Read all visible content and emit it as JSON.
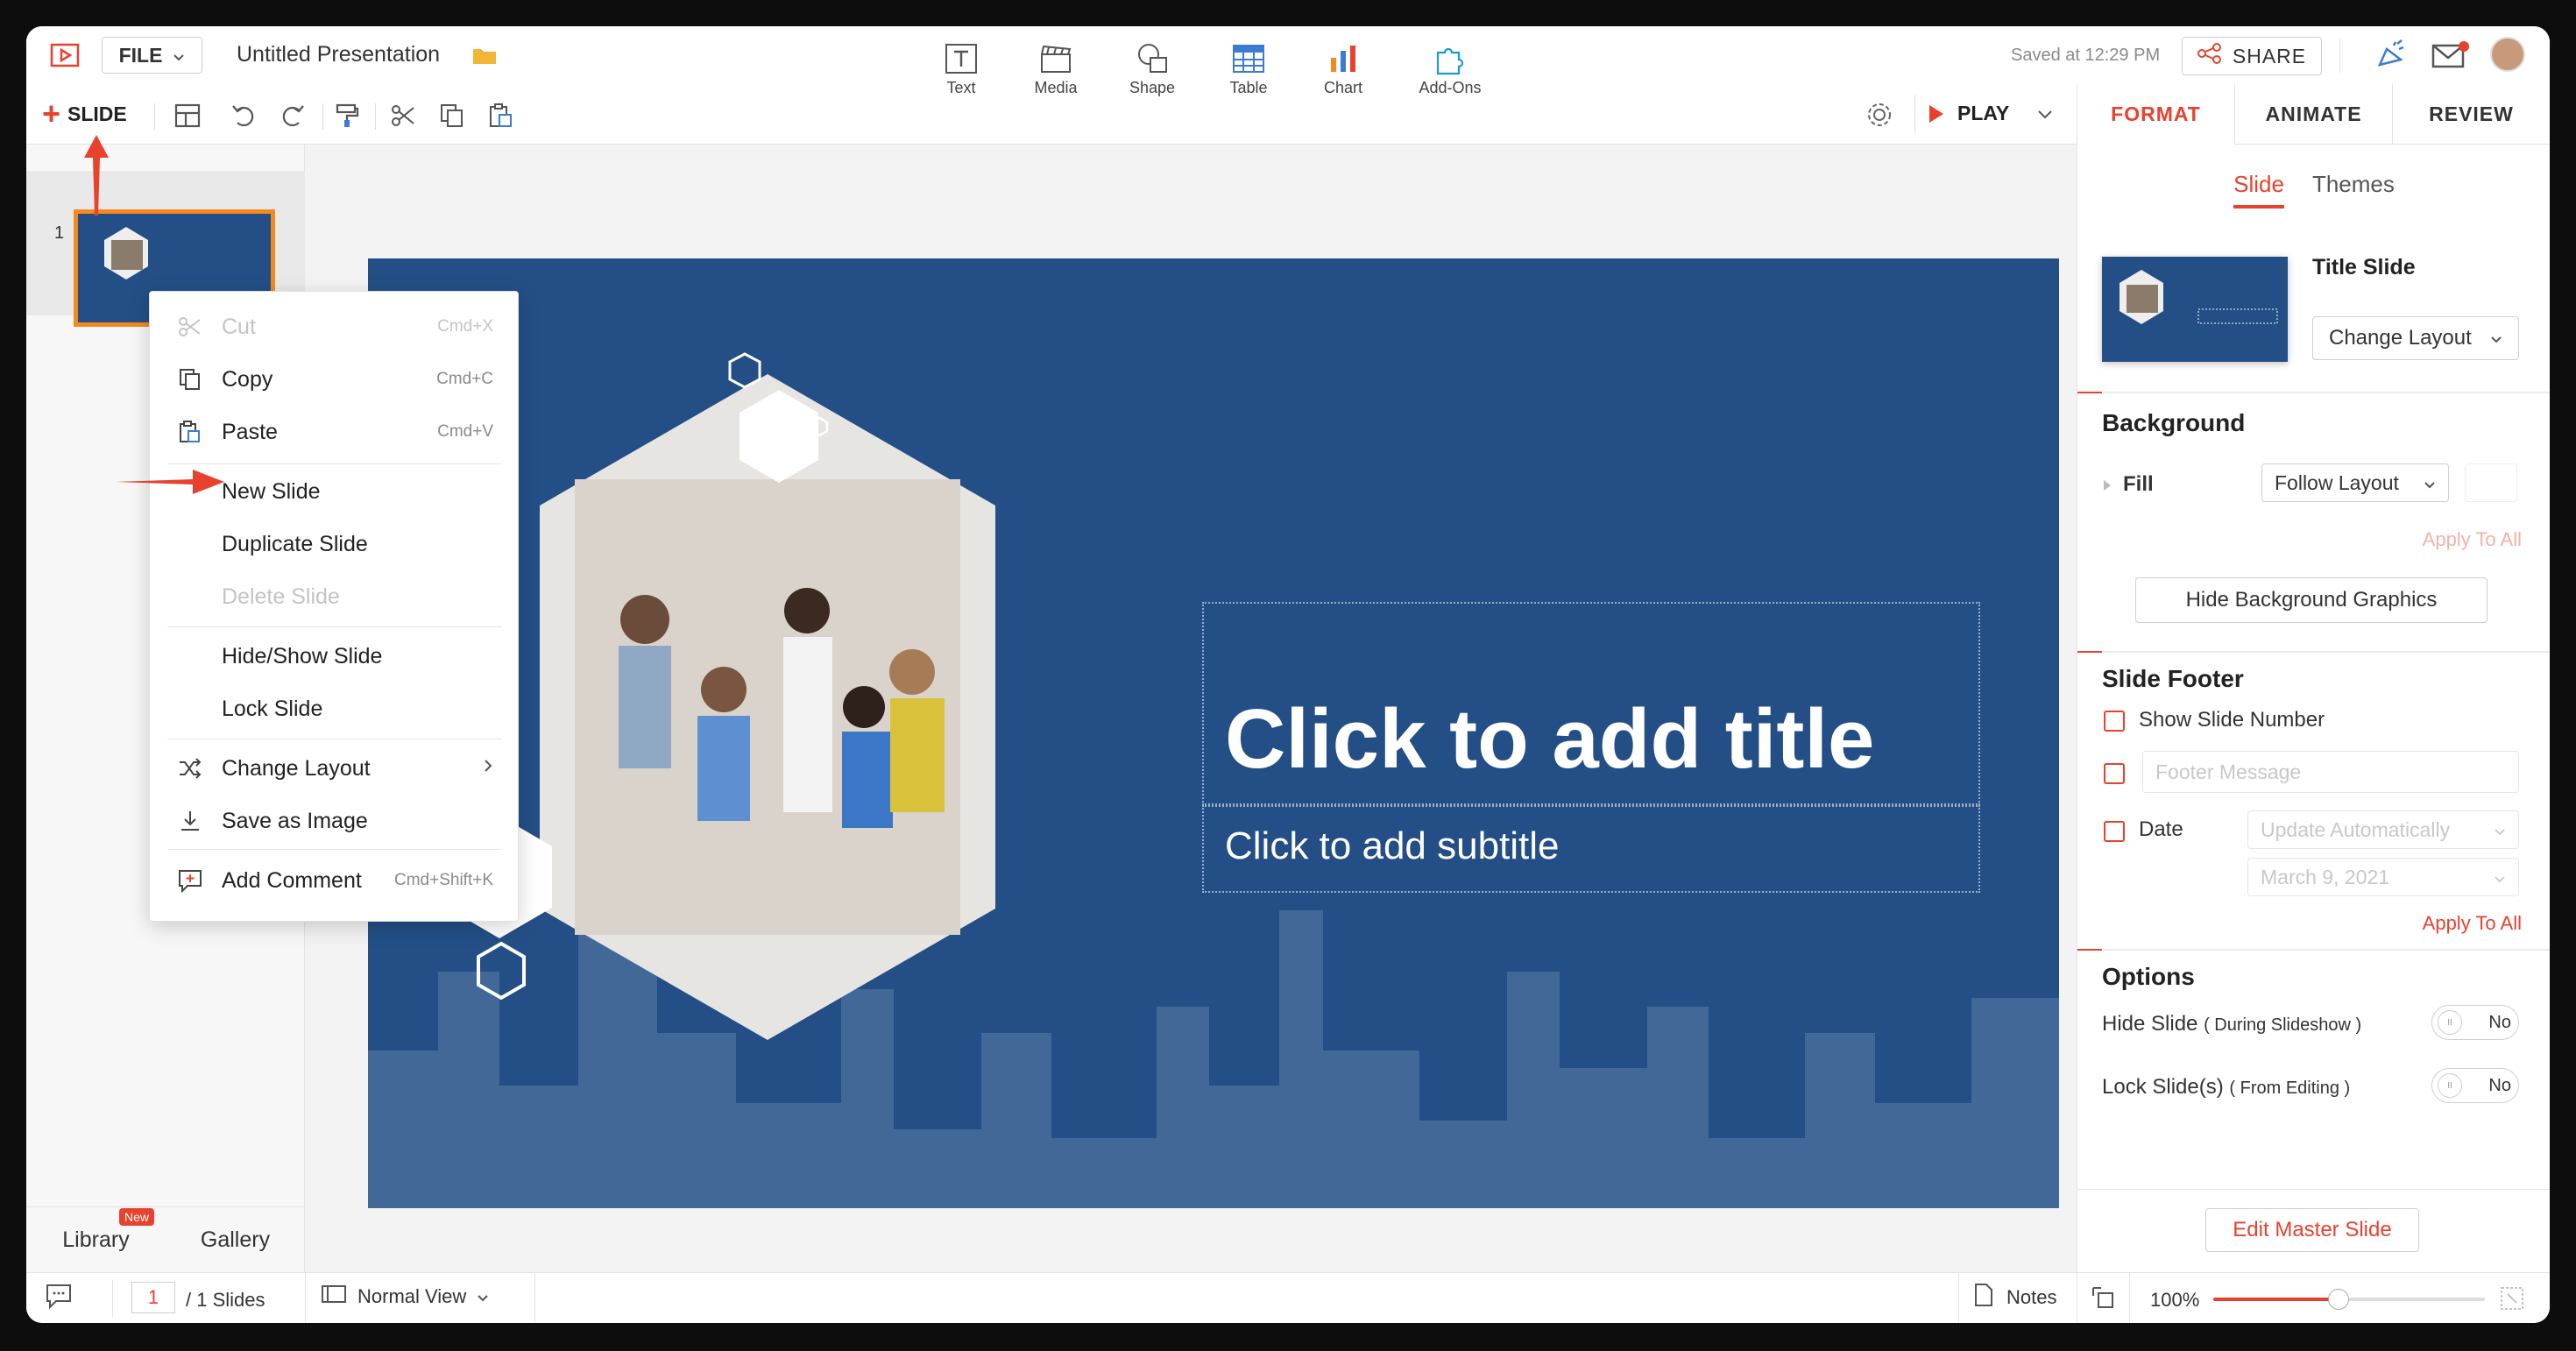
{
  "app": {
    "file_label": "FILE",
    "presentation_title": "Untitled Presentation",
    "saved_text": "Saved at 12:29 PM",
    "share_label": "SHARE"
  },
  "toolbar": {
    "slide_label": "SLIDE",
    "insert": [
      {
        "label": "Text"
      },
      {
        "label": "Media"
      },
      {
        "label": "Shape"
      },
      {
        "label": "Table"
      },
      {
        "label": "Chart"
      },
      {
        "label": "Add-Ons"
      }
    ],
    "play_label": "PLAY"
  },
  "right_tabs": [
    "FORMAT",
    "ANIMATE",
    "REVIEW"
  ],
  "left_panel": {
    "slide_number": "1",
    "library_label": "Library",
    "new_badge": "New",
    "gallery_label": "Gallery"
  },
  "slide": {
    "title_placeholder": "Click to add title",
    "subtitle_placeholder": "Click to add subtitle"
  },
  "context_menu": [
    {
      "label": "Cut",
      "shortcut": "Cmd+X",
      "disabled": true,
      "icon": "scissors-icon"
    },
    {
      "label": "Copy",
      "shortcut": "Cmd+C",
      "disabled": false,
      "icon": "copy-icon"
    },
    {
      "label": "Paste",
      "shortcut": "Cmd+V",
      "disabled": false,
      "icon": "paste-icon"
    },
    {
      "label": "New Slide",
      "shortcut": "",
      "disabled": false,
      "icon": ""
    },
    {
      "label": "Duplicate Slide",
      "shortcut": "",
      "disabled": false,
      "icon": ""
    },
    {
      "label": "Delete Slide",
      "shortcut": "",
      "disabled": true,
      "icon": ""
    },
    {
      "label": "Hide/Show Slide",
      "shortcut": "",
      "disabled": false,
      "icon": ""
    },
    {
      "label": "Lock Slide",
      "shortcut": "",
      "disabled": false,
      "icon": ""
    },
    {
      "label": "Change Layout",
      "shortcut": "",
      "disabled": false,
      "icon": "shuffle-icon"
    },
    {
      "label": "Save as Image",
      "shortcut": "",
      "disabled": false,
      "icon": "download-icon"
    },
    {
      "label": "Add Comment",
      "shortcut": "Cmd+Shift+K",
      "disabled": false,
      "icon": "comment-icon"
    }
  ],
  "format_panel": {
    "subtabs": [
      "Slide",
      "Themes"
    ],
    "layout_name": "Title Slide",
    "change_layout_label": "Change Layout",
    "background_title": "Background",
    "fill_label": "Fill",
    "fill_value": "Follow Layout",
    "apply_to_all": "Apply To All",
    "hide_bg_graphics": "Hide Background Graphics",
    "footer_title": "Slide Footer",
    "show_slide_number": "Show Slide Number",
    "footer_message_placeholder": "Footer Message",
    "date_label": "Date",
    "date_mode": "Update Automatically",
    "date_value": "March 9, 2021",
    "apply_to_all_2": "Apply To All",
    "options_title": "Options",
    "hide_slide_label": "Hide Slide",
    "hide_slide_note": "( During Slideshow )",
    "lock_slide_label": "Lock Slide(s)",
    "lock_slide_note": "( From Editing )",
    "toggle_no": "No",
    "toggle_knob": "II",
    "edit_master": "Edit Master Slide"
  },
  "status_bar": {
    "page": "1",
    "total": "/ 1 Slides",
    "view": "Normal View",
    "notes": "Notes",
    "zoom": "100%",
    "zoom_level": 0.46
  },
  "colors": {
    "accent": "#e8412e",
    "slide_bg": "#234f86",
    "thumb_border": "#f4891f"
  }
}
